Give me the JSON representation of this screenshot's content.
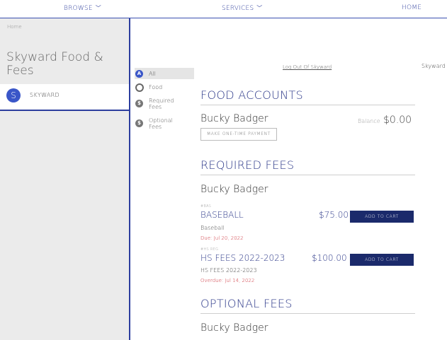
{
  "topnav": {
    "browse_label": "BROWSE",
    "services_label": "SERVICES",
    "home_label": "HOME"
  },
  "sidebar": {
    "breadcrumb": "Home",
    "title": "Skyward Food & Fees",
    "account": {
      "avatar_letter": "S",
      "name": "SKYWARD"
    }
  },
  "filters": [
    {
      "label": "All",
      "icon": "A"
    },
    {
      "label": "Food",
      "icon": ""
    },
    {
      "label": "Required Fees",
      "icon": "$"
    },
    {
      "label": "Optional Fees",
      "icon": "$"
    }
  ],
  "main": {
    "logout_label": "Log Out Of Skyward",
    "skyward_label": "Skyward",
    "food": {
      "heading": "FOOD ACCOUNTS",
      "person": "Bucky Badger",
      "balance_label": "Balance",
      "balance_value": "$0.00",
      "pay_button": "MAKE ONE-TIME PAYMENT"
    },
    "required": {
      "heading": "REQUIRED FEES",
      "person": "Bucky Badger",
      "fees": [
        {
          "code": "#BAS",
          "name": "BASEBALL",
          "amount": "$75.00",
          "desc": "Baseball",
          "due": "Due: Jul 20, 2022",
          "button": "ADD TO CART"
        },
        {
          "code": "#HS REG",
          "name": "HS FEES 2022-2023",
          "amount": "$100.00",
          "desc": "HS FEES 2022-2023",
          "due": "Overdue: Jul 14, 2022",
          "button": "ADD TO CART"
        }
      ]
    },
    "optional": {
      "heading": "OPTIONAL FEES",
      "person": "Bucky Badger"
    }
  },
  "colors": {
    "accent": "#2c3e9e",
    "button": "#1b2a6b",
    "due": "#c8202a",
    "avatar": "#3a56c8"
  }
}
